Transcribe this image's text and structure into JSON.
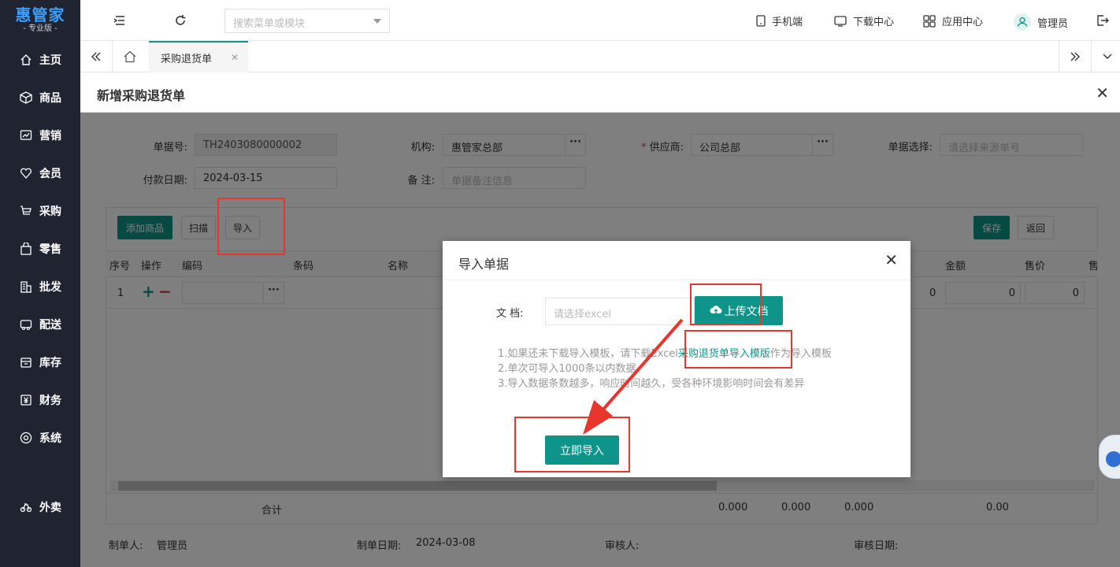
{
  "sidebar": {
    "logo_title": "惠管家",
    "logo_subtitle": "- 专业版 -",
    "items": [
      {
        "label": "主页",
        "icon": "home-icon"
      },
      {
        "label": "商品",
        "icon": "cube-icon"
      },
      {
        "label": "营销",
        "icon": "chart-icon"
      },
      {
        "label": "会员",
        "icon": "heart-icon"
      },
      {
        "label": "采购",
        "icon": "cart-icon"
      },
      {
        "label": "零售",
        "icon": "bag-icon"
      },
      {
        "label": "批发",
        "icon": "building-icon"
      },
      {
        "label": "配送",
        "icon": "truck-icon"
      },
      {
        "label": "库存",
        "icon": "box-icon"
      },
      {
        "label": "财务",
        "icon": "yen-icon"
      },
      {
        "label": "系统",
        "icon": "gear-icon"
      },
      {
        "label": "外卖",
        "icon": "bike-icon"
      }
    ]
  },
  "topbar": {
    "search_placeholder": "搜索菜单或模块",
    "mobile": "手机端",
    "download": "下载中心",
    "apps": "应用中心",
    "user": "管理员"
  },
  "tabs": {
    "active": "采购退货单"
  },
  "page": {
    "title": "新增采购退货单"
  },
  "form": {
    "order_no_label": "单据号:",
    "order_no": "TH2403080000002",
    "org_label": "机构:",
    "org": "惠管家总部",
    "supplier_label": "供应商:",
    "supplier_required": "*",
    "supplier": "公司总部",
    "source_label": "单据选择:",
    "source_placeholder": "请选择来源单号",
    "pay_date_label": "付款日期:",
    "pay_date": "2024-03-15",
    "remark_label": "备 注:",
    "remark_placeholder": "单据备注信息"
  },
  "toolbar": {
    "add": "添加商品",
    "scan": "扫描",
    "import": "导入",
    "save": "保存",
    "back": "返回"
  },
  "grid": {
    "headers": [
      "序号",
      "操作",
      "编码",
      "条码",
      "名称",
      "金额",
      "售价",
      "售"
    ],
    "row_no": "1",
    "row_vals": [
      "0",
      "0",
      "0"
    ],
    "total_label": "合计",
    "totals": [
      "0.000",
      "0.000",
      "0.000",
      "0.00"
    ]
  },
  "footer": {
    "creator_label": "制单人:",
    "creator": "管理员",
    "create_date_label": "制单日期:",
    "create_date": "2024-03-08",
    "auditor_label": "审核人:",
    "audit_date_label": "审核日期:"
  },
  "modal": {
    "title": "导入单据",
    "doc_label": "文 档:",
    "doc_placeholder": "请选择excel",
    "upload": "上传文档",
    "tip1_pre": "1.如果还未下载导入模板，请下载Excel",
    "tip1_link": "采购退货单导入模版",
    "tip1_post": "作为导入模板",
    "tip2": "2.单次可导入1000条以内数据",
    "tip3": "3.导入数据条数越多，响应时间越久，受各种环境影响时间会有差异",
    "import_now": "立即导入"
  },
  "colors": {
    "primary": "#0e9488",
    "sidebar": "#1f2430",
    "annotation": "#e8362d"
  }
}
